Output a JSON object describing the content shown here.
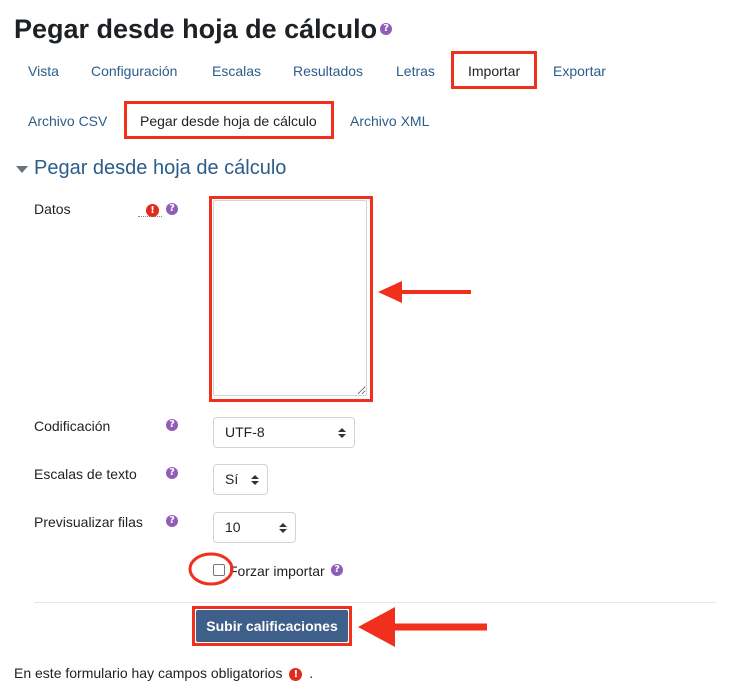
{
  "page": {
    "title": "Pegar desde hoja de cálculo"
  },
  "tabs": [
    {
      "label": "Vista"
    },
    {
      "label": "Configuración"
    },
    {
      "label": "Escalas"
    },
    {
      "label": "Resultados"
    },
    {
      "label": "Letras"
    },
    {
      "label": "Importar",
      "active": true
    },
    {
      "label": "Exportar"
    }
  ],
  "subtabs": [
    {
      "label": "Archivo CSV"
    },
    {
      "label": "Pegar desde hoja de cálculo",
      "active": true
    },
    {
      "label": "Archivo XML"
    }
  ],
  "form": {
    "section_title": "Pegar desde hoja de cálculo",
    "datos_label": "Datos",
    "datos_value": "",
    "codificacion_label": "Codificación",
    "codificacion_value": "UTF-8",
    "escalas_label": "Escalas de texto",
    "escalas_value": "Sí",
    "previsualizar_label": "Previsualizar filas",
    "previsualizar_value": "10",
    "forzar_label": "Forzar importar",
    "forzar_checked": false,
    "submit_label": "Subir calificaciones"
  },
  "footer": {
    "required_note": "En este formulario hay campos obligatorios",
    "period": "."
  },
  "icons": {
    "help": "question-circle-icon",
    "required": "exclamation-circle-icon"
  },
  "colors": {
    "link": "#2b5d8a",
    "help": "#8f5db7",
    "required": "#e02b20",
    "button": "#3e5f8a",
    "annotation": "#f0301c"
  }
}
